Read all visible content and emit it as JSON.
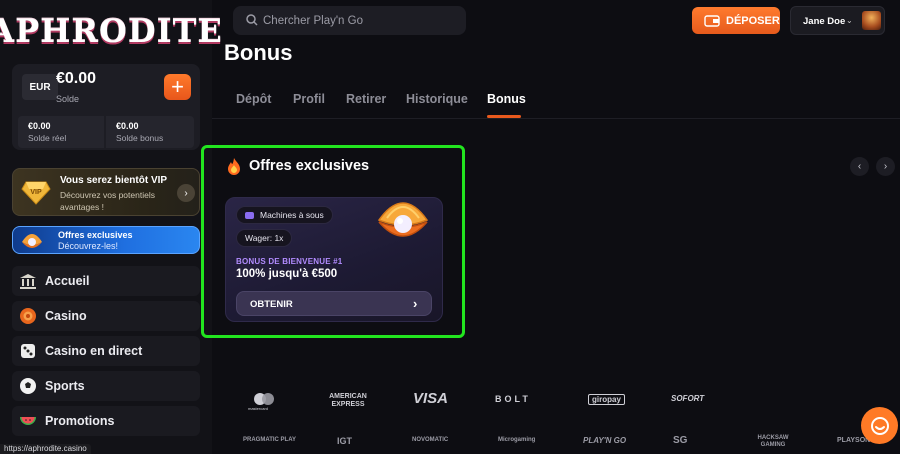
{
  "brand": {
    "name": "APHRODITE"
  },
  "wallet": {
    "currency": "EUR",
    "balance": "€0.00",
    "balance_label": "Solde",
    "real_value": "€0.00",
    "real_label": "Solde réel",
    "bonus_value": "€0.00",
    "bonus_label": "Solde bonus",
    "add_label": "+"
  },
  "vip": {
    "badge": "VIP",
    "title": "Vous serez bientôt VIP",
    "subtitle": "Découvrez vos potentiels avantages !"
  },
  "exclusive_banner": {
    "title": "Offres exclusives",
    "subtitle": "Découvrez-les!"
  },
  "nav": [
    {
      "label": "Accueil",
      "icon": "bank-icon"
    },
    {
      "label": "Casino",
      "icon": "chip-icon"
    },
    {
      "label": "Casino en direct",
      "icon": "dice-icon"
    },
    {
      "label": "Sports",
      "icon": "soccer-ball-icon"
    },
    {
      "label": "Promotions",
      "icon": "watermelon-icon"
    }
  ],
  "status_url": "https://aphrodite.casino",
  "search": {
    "placeholder": "Chercher Play'n Go"
  },
  "header": {
    "deposit_label": "DÉPOSER",
    "user_name": "Jane Doe"
  },
  "page": {
    "title": "Bonus",
    "tabs": [
      "Dépôt",
      "Profil",
      "Retirer",
      "Historique",
      "Bonus"
    ],
    "active_tab": "Bonus"
  },
  "offers": {
    "section_title": "Offres exclusives",
    "card": {
      "category": "Machines à sous",
      "wager": "Wager: 1x",
      "kicker": "BONUS DE BIENVENUE #1",
      "title": "100% jusqu'à €500",
      "cta": "OBTENIR"
    }
  },
  "payments": [
    "mastercard",
    "AMERICAN EXPRESS",
    "VISA",
    "BOLT",
    "giropay",
    "SOFORT"
  ],
  "providers": [
    "PRAGMATIC PLAY",
    "IGT",
    "NOVOMATIC",
    "Microgaming",
    "PLAY'N GO",
    "SG",
    "HACKSAW GAMING",
    "PLAYSON"
  ],
  "colors": {
    "accent": "#e8591d",
    "highlight": "#22e51f",
    "vip_gold": "#f0b73a",
    "exclusive_blue": "#1f6fe0"
  }
}
